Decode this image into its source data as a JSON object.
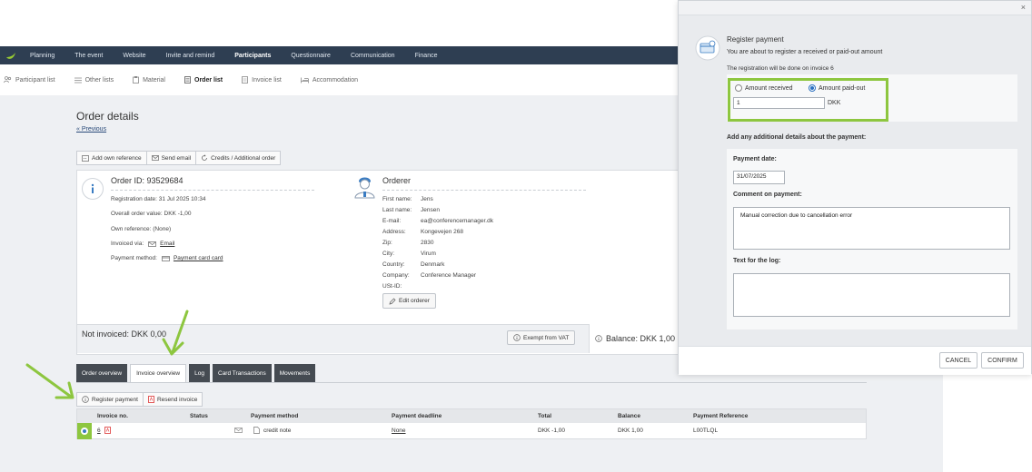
{
  "nav": {
    "items": [
      "Planning",
      "The event",
      "Website",
      "Invite and remind",
      "Participants",
      "Questionnaire",
      "Communication",
      "Finance"
    ],
    "active": "Participants"
  },
  "subnav": {
    "items": [
      "Participant list",
      "Other lists",
      "Material",
      "Order list",
      "Invoice list",
      "Accommodation"
    ],
    "active": "Order list"
  },
  "page": {
    "title": "Order details",
    "previous": "« Previous",
    "buttons": [
      "Add own reference",
      "Send email",
      "Credits / Additional order"
    ]
  },
  "order": {
    "id": "Order ID: 93529684",
    "registration_date": "Registration date: 31 Jul 2025 10:34",
    "overall_value": "Overall order value: DKK -1,00",
    "own_reference": "Own reference: (None)",
    "invoiced_via_label": "Invoiced via:",
    "invoiced_via_value": "Email",
    "payment_method_label": "Payment method:",
    "payment_method_value": "Payment card card"
  },
  "orderer": {
    "title": "Orderer",
    "fields": [
      {
        "k": "First name:",
        "v": "Jens"
      },
      {
        "k": "Last name:",
        "v": "Jensen"
      },
      {
        "k": "E-mail:",
        "v": "ea@conferencemanager.dk"
      },
      {
        "k": "Address:",
        "v": "Kongevejen 268"
      },
      {
        "k": "Zip:",
        "v": "2830"
      },
      {
        "k": "City:",
        "v": "Virum"
      },
      {
        "k": "Country:",
        "v": "Denmark"
      },
      {
        "k": "Company:",
        "v": "Conference Manager"
      },
      {
        "k": "USt-ID:",
        "v": ""
      }
    ],
    "edit_button": "Edit orderer"
  },
  "footer": {
    "not_invoiced": "Not invoiced: DKK 0,00",
    "exempt_vat": "Exempt from VAT",
    "balance": "Balance: DKK 1,00"
  },
  "tabs": [
    "Order overview",
    "Invoice overview",
    "Log",
    "Card Transactions",
    "Movements"
  ],
  "active_tab": "Invoice overview",
  "invoice_actions": [
    "Register payment",
    "Resend invoice"
  ],
  "invoice_table": {
    "headers": [
      "Invoice no.",
      "Status",
      "Payment method",
      "Payment deadline",
      "Total",
      "Balance",
      "Payment Reference"
    ],
    "rows": [
      {
        "invoice_no": "6",
        "status": "",
        "payment_method": "credit note",
        "deadline": "None",
        "total": "DKK -1,00",
        "balance": "DKK 1,00",
        "reference": "L00TLQL"
      }
    ]
  },
  "dialog": {
    "close": "×",
    "title": "Register payment",
    "subtitle": "You are about to register a received or paid-out amount",
    "note": "The registration will be done on invoice 6",
    "radio_received": "Amount received",
    "radio_paidout": "Amount paid-out",
    "selected": "paid-out",
    "amount": "1",
    "currency": "DKK",
    "details_heading": "Add any additional details about the payment:",
    "payment_date_label": "Payment date:",
    "payment_date": "31/07/2025",
    "comment_label": "Comment on payment:",
    "comment": "Manual correction due to cancellation error",
    "log_label": "Text for the log:",
    "log_text": "",
    "cancel": "CANCEL",
    "confirm": "CONFIRM"
  },
  "colors": {
    "nav_bg": "#2e3e52",
    "highlight": "#8dc63f",
    "tab_dark": "#454b52"
  }
}
